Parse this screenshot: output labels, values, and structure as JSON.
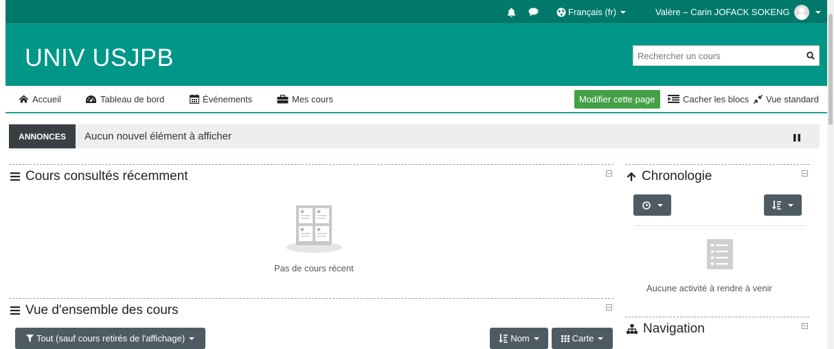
{
  "topbar": {
    "bell_icon": "bell-icon",
    "chat_icon": "chat-icon",
    "language": "Français (fr)",
    "user_name": "Valère – Carin JOFACK SOKENG"
  },
  "header": {
    "site_name": "UNIV USJPB",
    "search_placeholder": "Rechercher un cours"
  },
  "nav": {
    "home": "Accueil",
    "dashboard": "Tableau de bord",
    "events": "Événements",
    "my_courses": "Mes cours",
    "edit_page": "Modifier cette page",
    "hide_blocks": "Cacher les blocs",
    "standard_view": "Vue standard"
  },
  "announcements": {
    "label": "ANNONCES",
    "message": "Aucun nouvel élément à afficher"
  },
  "recent_courses": {
    "title": "Cours consultés récemment",
    "empty": "Pas de cours récent"
  },
  "overview": {
    "title": "Vue d'ensemble des cours",
    "filter": "Tout (sauf cours retirés de l'affichage)",
    "sort": "Nom",
    "view": "Carte"
  },
  "timeline": {
    "title": "Chronologie",
    "empty": "Aucune activité à rendre à venir"
  },
  "navigation": {
    "title": "Navigation"
  },
  "colors": {
    "topbar": "#00796b",
    "header": "#009688",
    "edit_button": "#43a047",
    "dark_button": "#4e5b63"
  }
}
